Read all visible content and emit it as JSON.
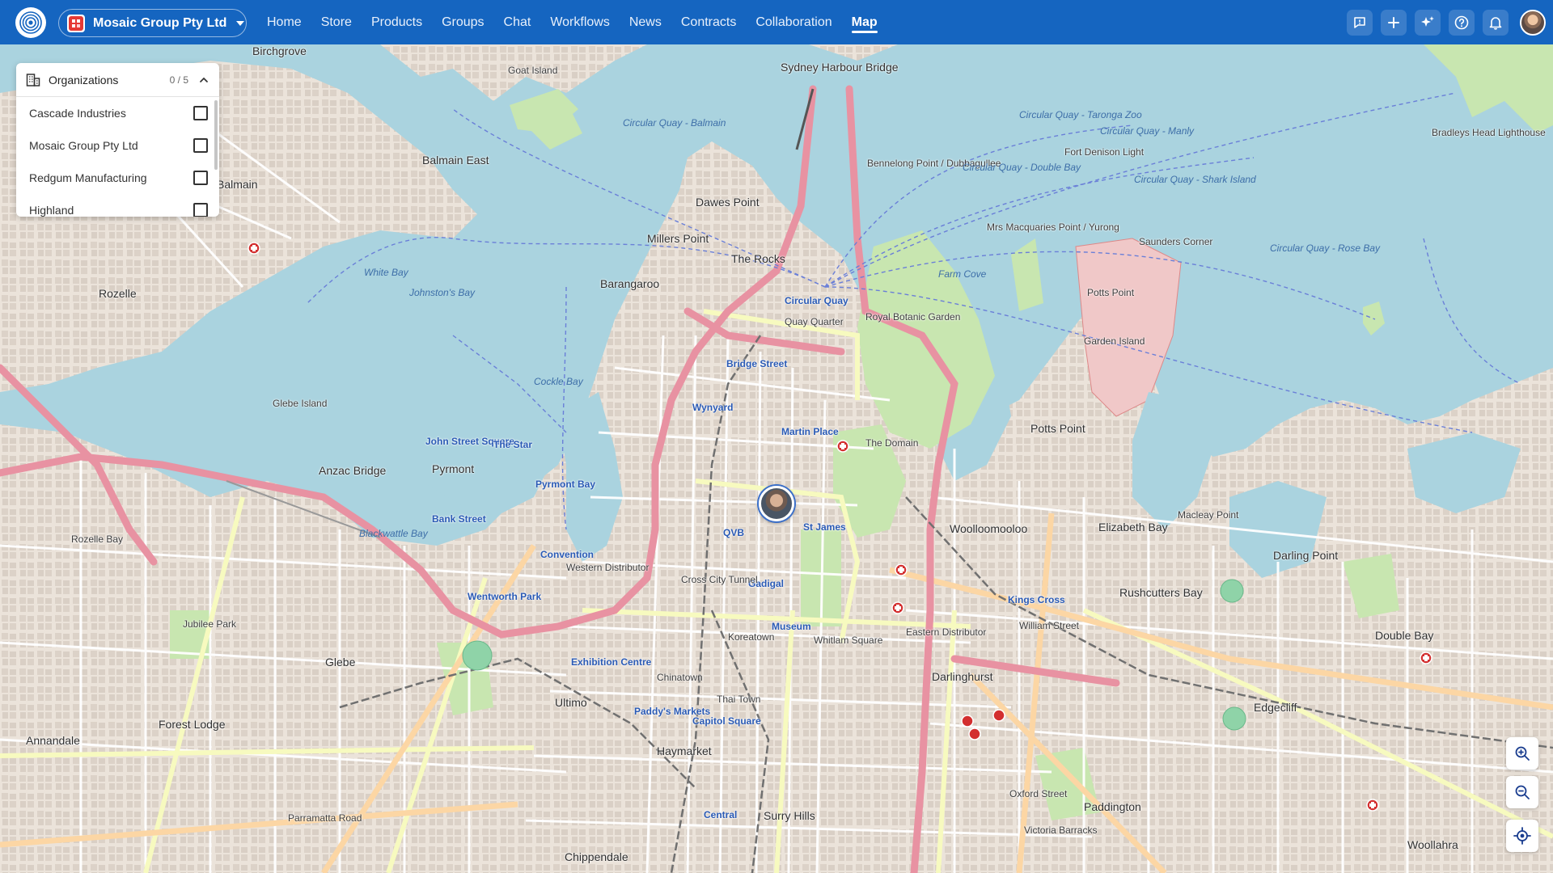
{
  "header": {
    "org_switcher": {
      "name": "Mosaic Group Pty Ltd"
    },
    "nav": [
      {
        "label": "Home"
      },
      {
        "label": "Store"
      },
      {
        "label": "Products"
      },
      {
        "label": "Groups"
      },
      {
        "label": "Chat"
      },
      {
        "label": "Workflows"
      },
      {
        "label": "News"
      },
      {
        "label": "Contracts"
      },
      {
        "label": "Collaboration"
      },
      {
        "label": "Map"
      }
    ],
    "active_nav": "Map",
    "action_icons": [
      "feedback-icon",
      "plus-icon",
      "sparkle-icon",
      "help-icon",
      "bell-icon",
      "user-avatar"
    ]
  },
  "org_panel": {
    "title": "Organizations",
    "count": "0 / 5",
    "items": [
      {
        "label": "Cascade Industries",
        "checked": false
      },
      {
        "label": "Mosaic Group Pty Ltd",
        "checked": false
      },
      {
        "label": "Redgum Manufacturing",
        "checked": false
      },
      {
        "label": "Highland",
        "checked": false
      }
    ]
  },
  "map": {
    "labels": {
      "sydney_harbour_bridge": "Sydney Harbour Bridge",
      "birchgrove": "Birchgrove",
      "balmain": "Balmain",
      "balmain_east": "Balmain East",
      "rozelle": "Rozelle",
      "rozelle_bay": "Rozelle Bay",
      "glebe": "Glebe",
      "glebe_island": "Glebe Island",
      "annandale": "Annandale",
      "forest_lodge": "Forest Lodge",
      "jubilee_park": "Jubilee Park",
      "pyrmont": "Pyrmont",
      "pyrmont_bay": "Pyrmont Bay",
      "john_street_square": "John Street Square",
      "the_star": "The Star",
      "millers_point": "Millers Point",
      "dawes_point": "Dawes Point",
      "the_rocks": "The Rocks",
      "barangaroo": "Barangaroo",
      "circular_quay": "Circular Quay",
      "circular_quay_quarter": "Quay Quarter",
      "wynyard": "Wynyard",
      "martin_place": "Martin Place",
      "st_james": "St James",
      "museum": "Museum",
      "qvb": "QVB",
      "town_hall": "Gadigal",
      "central": "Central",
      "haymarket": "Haymarket",
      "chinatown": "Chinatown",
      "ultimo": "Ultimo",
      "exhibition_centre": "Exhibition Centre",
      "paddys_markets": "Paddy's Markets",
      "capitol_square": "Capitol Square",
      "surry_hills": "Surry Hills",
      "chippendale": "Chippendale",
      "darlinghurst": "Darlinghurst",
      "woolloomooloo": "Woolloomooloo",
      "kings_cross": "Kings Cross",
      "potts_point": "Potts Point",
      "elizabeth_bay": "Elizabeth Bay",
      "rushcutters_bay": "Rushcutters Bay",
      "darling_point": "Darling Point",
      "double_bay": "Double Bay",
      "edgecliff": "Edgecliff",
      "paddington": "Paddington",
      "woollahra": "Woollahra",
      "garden_island": "Garden Island",
      "royal_botanic_garden": "Royal Botanic Garden",
      "the_domain": "The Domain",
      "farm_cove": "Farm Cove",
      "mrs_macquaries_point": "Mrs Macquaries Point / Yurong",
      "bennelong_point": "Bennelong Point / Dubbagullee",
      "fort_denison": "Fort Denison Light",
      "bradleys_head": "Bradleys Head Lighthouse",
      "anzac_bridge": "Anzac Bridge",
      "bank_street": "Bank Street",
      "convention": "Convention",
      "wentworth_park": "Wentworth Park",
      "cross_city_tunnel": "Cross City Tunnel",
      "william_street": "William Street",
      "oxford_street": "Oxford Street",
      "parramatta_road": "Parramatta Road",
      "eastern_distributor": "Eastern Distributor",
      "western_distributor": "Western Distributor",
      "bridge_street": "Bridge Street",
      "goat_island": "Goat Island",
      "saunders_corner": "Saunders Corner",
      "potts_point_2": "Potts Point",
      "macleay_point": "Macleay Point",
      "victoria_barracks": "Victoria Barracks",
      "whitlam_square": "Whitlam Square",
      "thai_town": "Thai Town",
      "koreatown": "Koreatown",
      "white_bay": "White Bay",
      "johnstons_bay": "Johnston's Bay",
      "blackwattle_bay": "Blackwattle Bay",
      "darling_harbour": "Cockle Bay"
    },
    "route_labels": {
      "cq_balmain": "Circular Quay - Balmain",
      "cq_manly": "Circular Quay - Manly",
      "cq_taronga": "Circular Quay - Taronga Zoo",
      "cq_rose_bay": "Circular Quay - Rose Bay",
      "cq_double_bay": "Circular Quay - Double Bay",
      "cq_shark_island": "Circular Quay - Shark Island"
    },
    "controls": {
      "zoom_in": "zoom-in-icon",
      "zoom_out": "zoom-out-icon",
      "locate": "locate-icon"
    }
  },
  "colors": {
    "header": "#1565c0",
    "water": "#aad3df",
    "land": "#f2efe9",
    "park": "#c8e6b0",
    "motorway": "#e892a2",
    "primary_road": "#fcd6a4",
    "secondary_road": "#f7fabf",
    "railway": "#707070",
    "ferry_route": "#6a7fd8"
  }
}
